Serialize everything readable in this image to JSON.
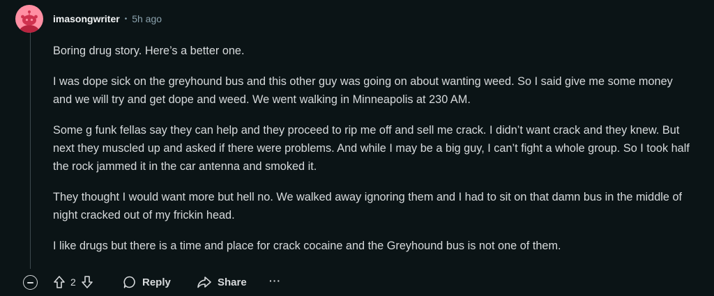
{
  "comment": {
    "username": "imasongwriter",
    "separator": "•",
    "timestamp": "5h ago",
    "paragraphs": [
      "Boring drug story. Here’s a better one.",
      "I was dope sick on the greyhound bus and this other guy was going on about wanting weed. So I said give me some money and we will try and get dope and weed. We went walking in Minneapolis at 230 AM.",
      "Some g funk fellas say they can help and they proceed to rip me off and sell me crack. I didn’t want crack and they knew. But next they muscled up and asked if there were problems. And while I may be a big guy, I can’t fight a whole group. So I took half the rock jammed it in the car antenna and smoked it.",
      "They thought I would want more but hell no. We walked away ignoring them and I had to sit on that damn bus in the middle of night cracked out of my frickin head.",
      "I like drugs but there is a time and place for crack cocaine and the Greyhound bus is not one of them."
    ]
  },
  "actions": {
    "vote_count": "2",
    "reply_label": "Reply",
    "share_label": "Share",
    "more_label": "···"
  },
  "colors": {
    "background": "#0b1416",
    "text": "#d7dadc",
    "meta": "#8ba2ad",
    "avatar": "#ff8fa3"
  },
  "icons": [
    "snoo-avatar-icon",
    "collapse-icon",
    "upvote-icon",
    "downvote-icon",
    "comment-icon",
    "share-icon",
    "more-icon"
  ]
}
